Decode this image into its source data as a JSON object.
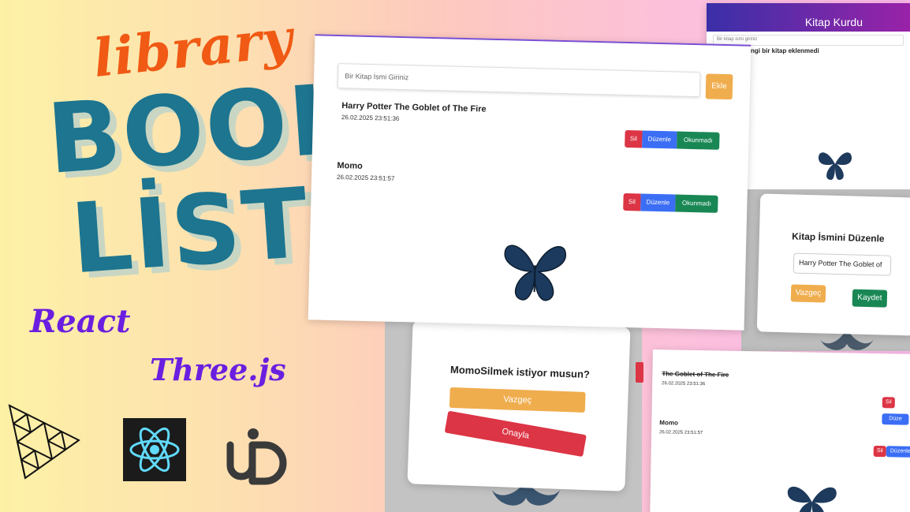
{
  "title_art": {
    "library": "library",
    "book": "BOOK",
    "list": "LİST",
    "react": "React",
    "threejs": "Three.js"
  },
  "main_panel": {
    "search_placeholder": "Bir Kitap İsmi Giriniz",
    "add_button": "Ekle",
    "books": [
      {
        "title": "Harry Potter The Goblet of The Fire",
        "date": "26.02.2025 23:51:36",
        "delete": "Sil",
        "edit": "Düzenle",
        "status": "Okunmadı"
      },
      {
        "title": "Momo",
        "date": "26.02.2025 23:51:57",
        "delete": "Sil",
        "edit": "Düzenle",
        "status": "Okunmadı"
      }
    ]
  },
  "top_panel": {
    "header": "Kitap Kurdu",
    "search_placeholder": "Bir kitap ismi giriniz",
    "empty_message": "Henuz herhangi bir kitap eklenmedi"
  },
  "edit_modal": {
    "title": "Kitap İsmini Düzenle",
    "input_value": "Harry Potter The Goblet of",
    "cancel": "Vazgeç",
    "save": "Kaydet"
  },
  "delete_modal": {
    "question": "MomoSilmek istiyor musun?",
    "cancel": "Vazgeç",
    "confirm": "Onayla"
  },
  "bottom_panel": {
    "books": [
      {
        "title": "The Goblet of The Fire",
        "date": "26.02.2025 23:51:36",
        "delete": "Sil",
        "edit": "Düze"
      },
      {
        "title": "Momo",
        "date": "26.02.2025 23:51:57",
        "delete": "Sil",
        "edit": "Düzenle"
      }
    ]
  },
  "colors": {
    "brand_teal": "#1d7590",
    "library_orange": "#f05a14",
    "purple": "#6a1fe0",
    "danger": "#dc3545",
    "primary": "#3b6ef5",
    "success": "#198754",
    "warning": "#f0ad4e"
  },
  "icons": [
    "threejs-logo-icon",
    "react-logo-icon",
    "uid-logo-icon",
    "butterfly-icon"
  ]
}
